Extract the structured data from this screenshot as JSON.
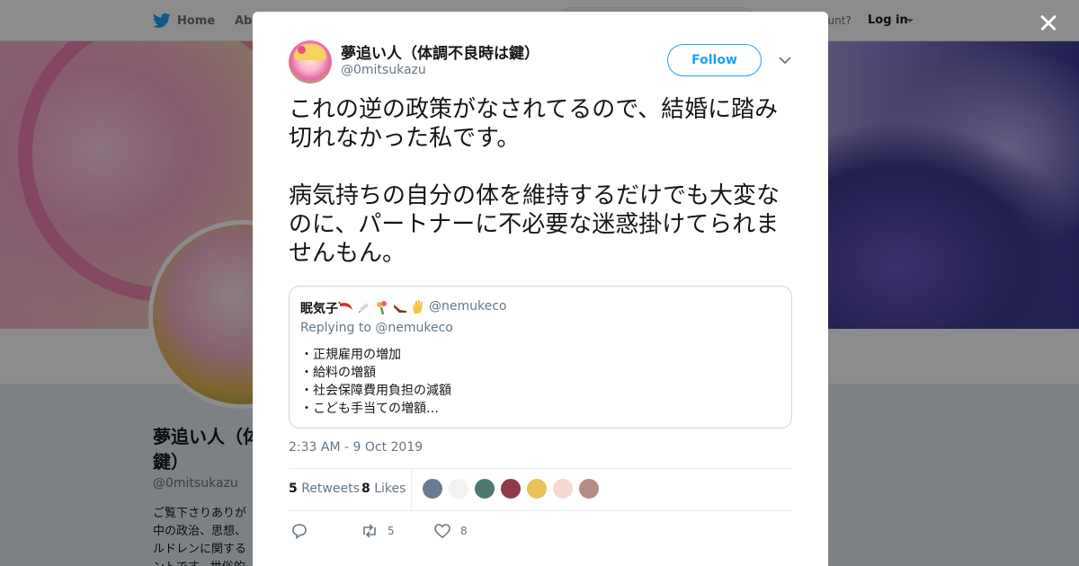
{
  "nav": {
    "home_label": "Home",
    "about_label": "Abo",
    "account_text": "ccount?",
    "login_label": "Log in"
  },
  "profile_bg": {
    "name_line1": "夢追い人（体",
    "name_line2": "鍵）",
    "handle": "@0mitsukazu",
    "bio_lines": [
      "ご覧下さりありが",
      "中の政治、思想、",
      "ルドレンに関する",
      "ントです。世俗的"
    ]
  },
  "tweet": {
    "author_name": "夢追い人（体調不良時は鍵）",
    "author_handle": "@0mitsukazu",
    "follow_label": "Follow",
    "text": "これの逆の政策がなされてるので、結婚に踏み切れなかった私です。\n\n病気持ちの自分の体を維持するだけでも大変なのに、パートナーに不必要な迷惑掛けてられませんもん。",
    "timestamp": "2:33 AM - 9 Oct 2019",
    "retweets_count": "5",
    "retweets_label": "Retweets",
    "likes_count": "8",
    "likes_label": "Likes",
    "action_retweet_count": "5",
    "action_like_count": "8"
  },
  "quote": {
    "author_name": "眠気子",
    "author_emoji": [
      "chili-pepper",
      "syringe",
      "bouquet",
      "shoe",
      "raised-hand"
    ],
    "author_handle": "@nemukeco",
    "reply_text": "Replying to @nemukeco",
    "lines": [
      "・正規雇用の増加",
      "・給料の増額",
      "・社会保障費用負担の減額",
      "・こども手当ての増額…"
    ]
  },
  "likers": {
    "colors": [
      "#6b7a93",
      "#f2f2f2",
      "#4c7a72",
      "#8d3b4a",
      "#e8c15a",
      "#f6d7d2",
      "#b88c86"
    ]
  },
  "colors": {
    "accent": "#1da1f2",
    "text_primary": "#14171a",
    "text_secondary": "#657786"
  }
}
